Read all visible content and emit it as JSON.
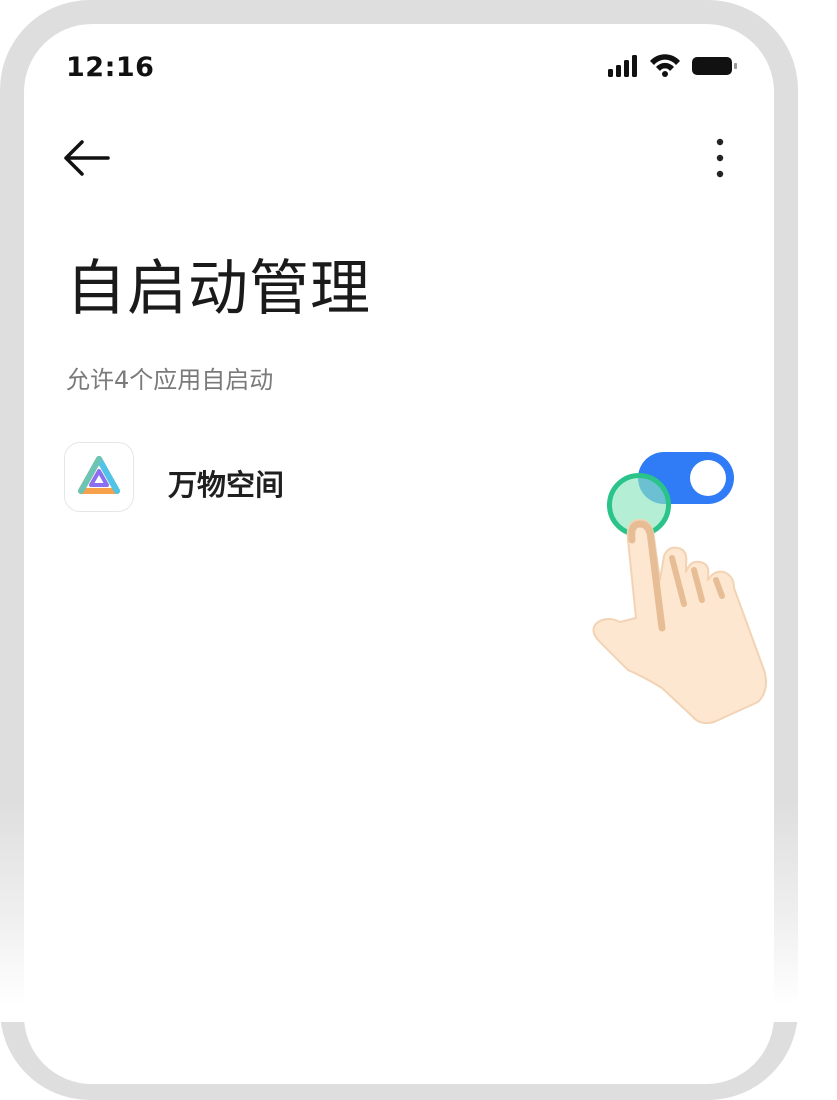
{
  "status_bar": {
    "time": "12:16",
    "icons": [
      "cellular-signal-icon",
      "wifi-icon",
      "battery-icon"
    ]
  },
  "toolbar": {
    "back_icon": "arrow-left-icon",
    "more_icon": "more-vertical-icon"
  },
  "page": {
    "title": "自启动管理",
    "subtitle": "允许4个应用自启动"
  },
  "apps": [
    {
      "name": "万物空间",
      "icon": "app-logo-icon",
      "autostart_enabled": true
    }
  ],
  "colors": {
    "toggle_on": "#2f7cf6",
    "tap_indicator": "#2ac48a",
    "frame": "#dedede"
  },
  "overlay": {
    "tap_hint_icon": "pointing-hand-icon"
  }
}
